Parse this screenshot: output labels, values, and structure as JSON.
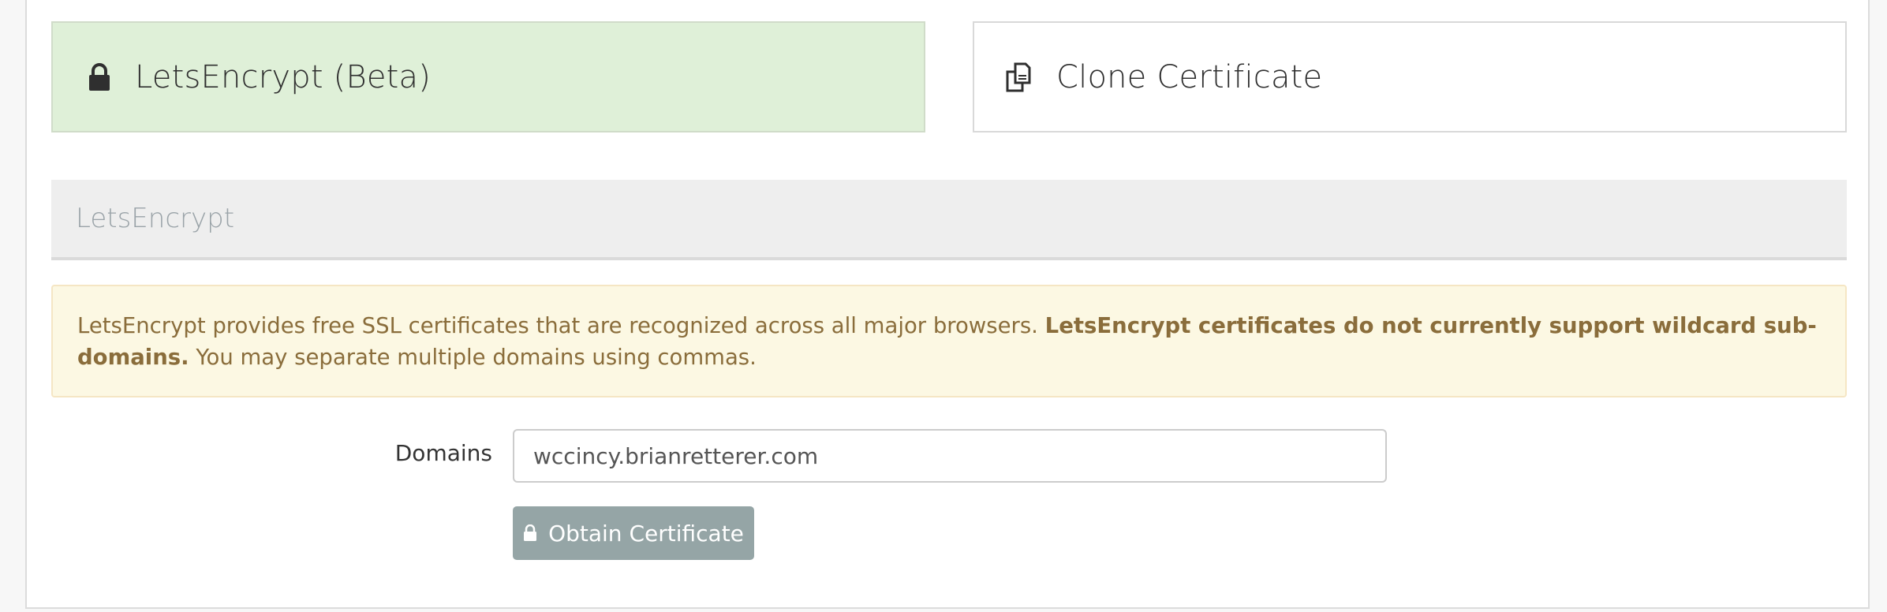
{
  "cards": {
    "letsencrypt": {
      "label": "LetsEncrypt (Beta)",
      "icon": "lock-icon"
    },
    "clone": {
      "label": "Clone Certificate",
      "icon": "copy-icon"
    }
  },
  "section": {
    "title": "LetsEncrypt"
  },
  "alert": {
    "text_before": "LetsEncrypt provides free SSL certificates that are recognized across all major browsers. ",
    "text_bold": "LetsEncrypt certificates do not currently support wildcard sub-domains.",
    "text_after": " You may separate multiple domains using commas."
  },
  "form": {
    "domains_label": "Domains",
    "domains_value": "wccincy.brianretterer.com",
    "submit_label": "Obtain Certificate",
    "submit_icon": "lock-icon"
  },
  "colors": {
    "active_card_bg": "#dff0d8",
    "alert_bg": "#fcf8e3",
    "alert_text": "#8a6d3b",
    "button_bg": "#95a5a6"
  }
}
